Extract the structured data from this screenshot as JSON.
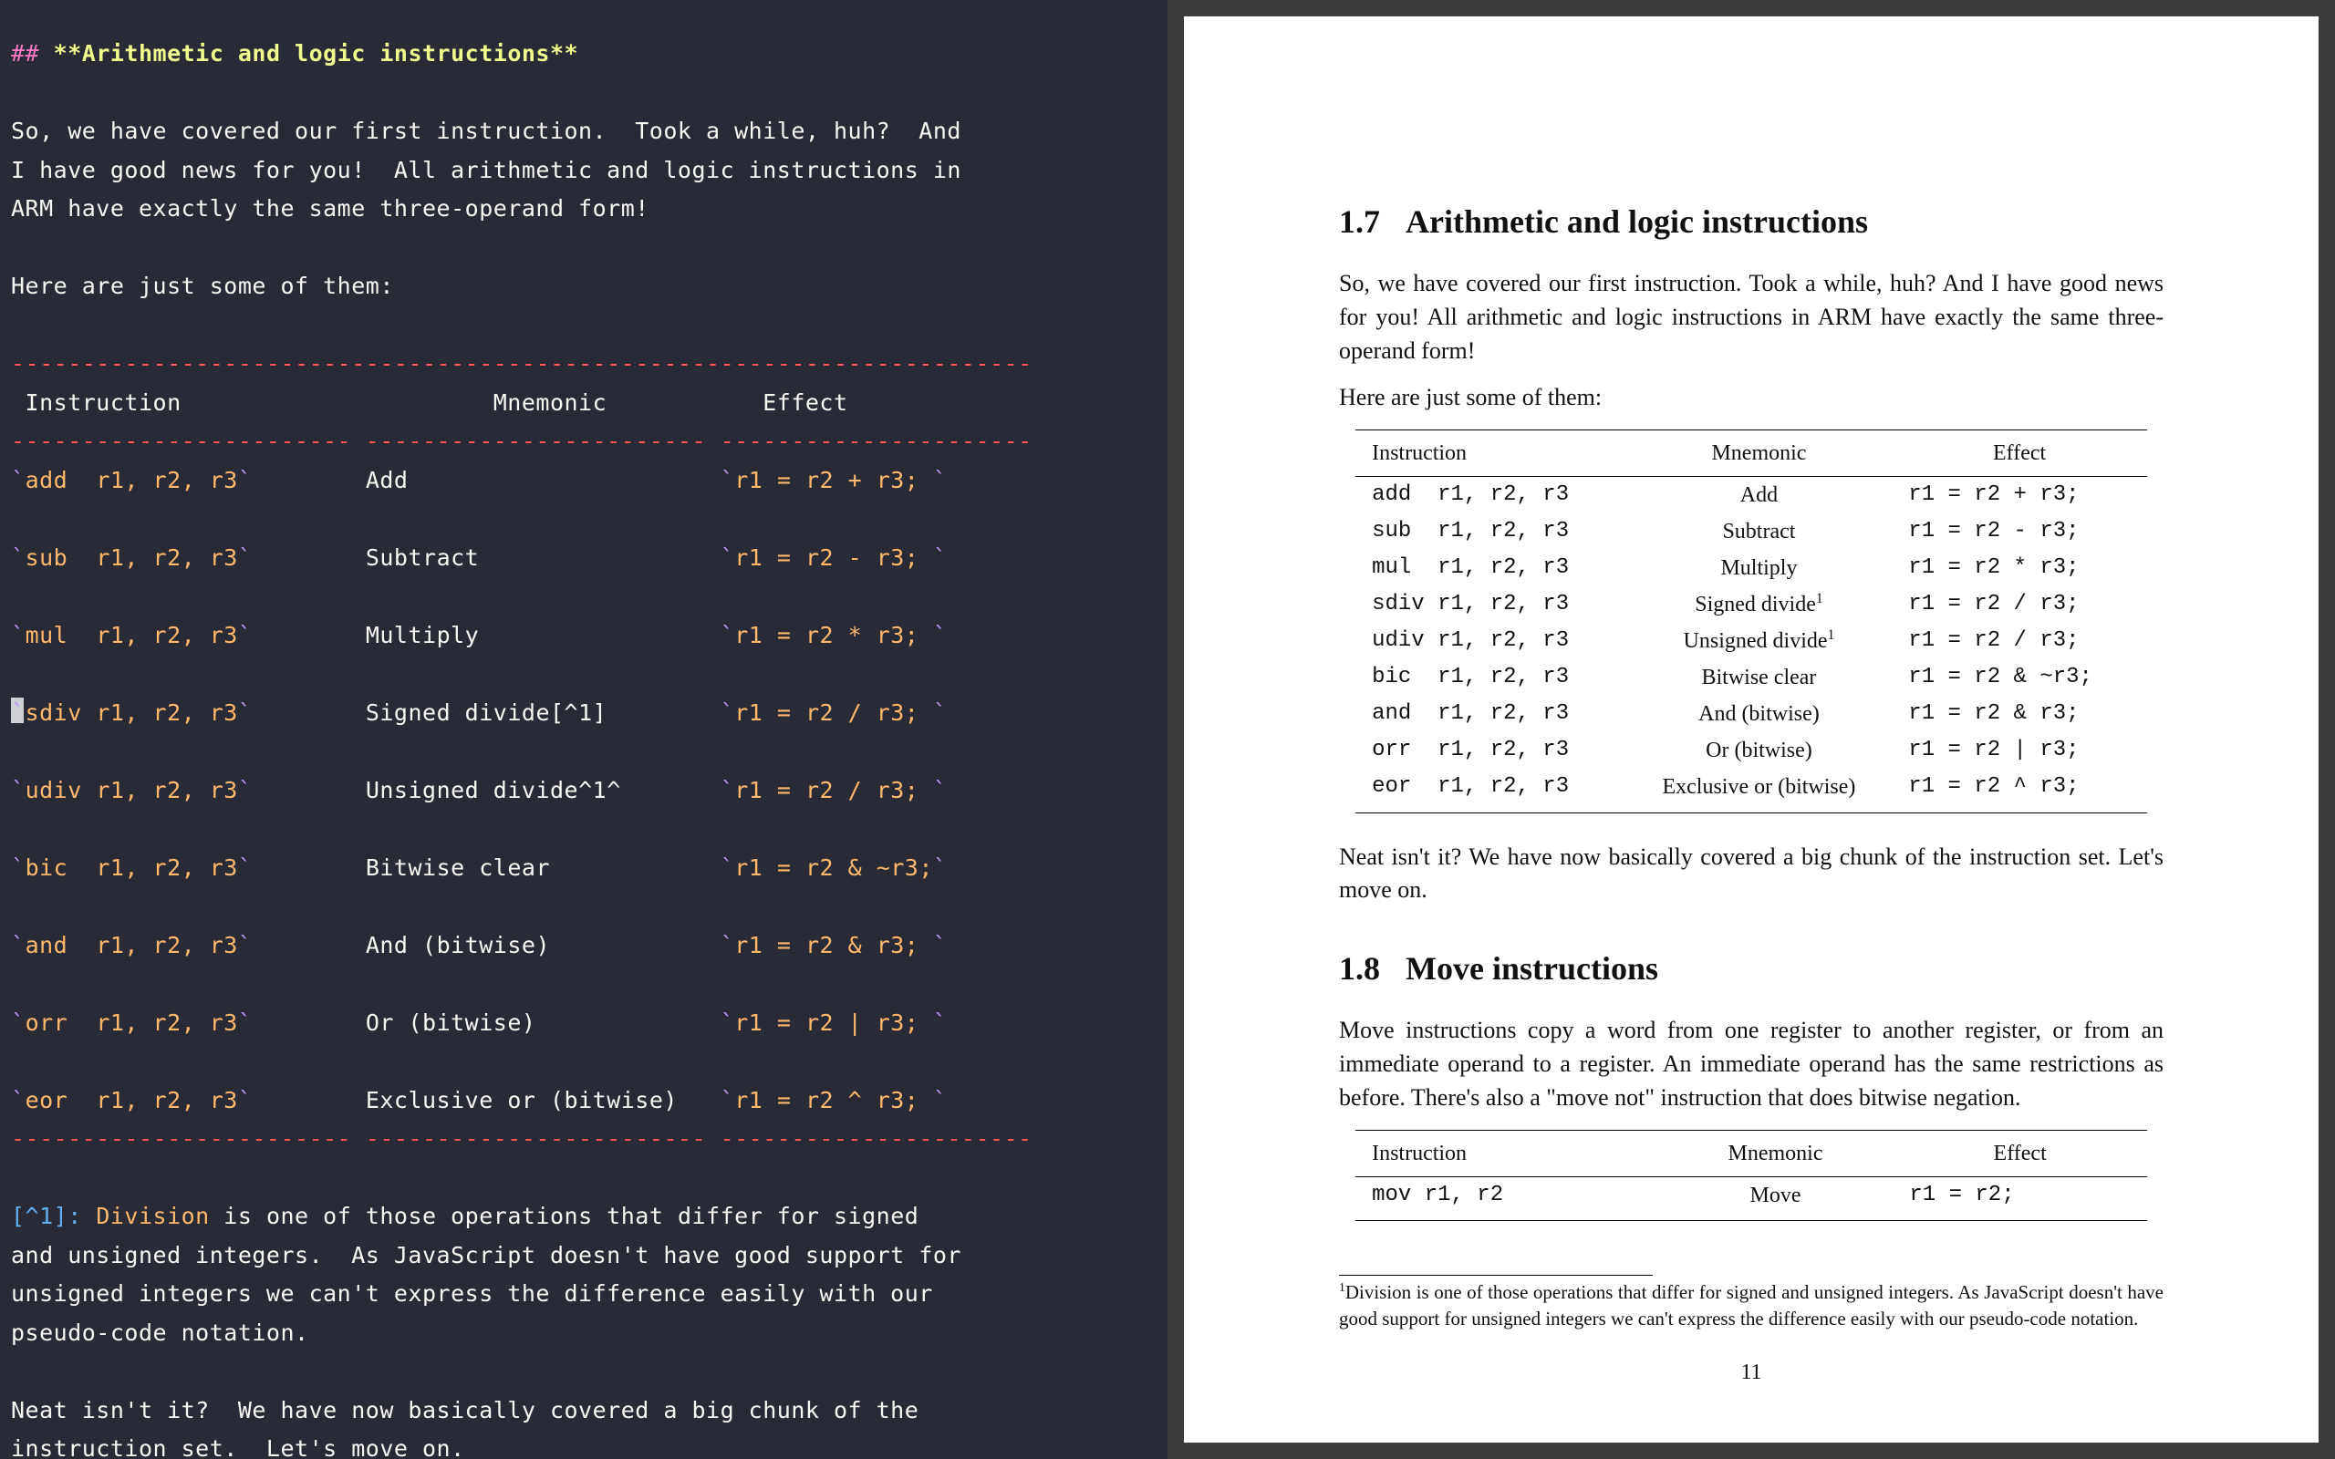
{
  "editor": {
    "header_marker": "##",
    "header_text": "Arithmetic and logic instructions",
    "para1_a": "So, we have covered our first instruction.  Took a while, huh?  And",
    "para1_b": "I have good news for you!  All arithmetic and logic instructions in",
    "para1_c": "ARM have exactly the same three-operand form!",
    "para2": "Here are just some of them:",
    "rule_top": "------------------------------------------------------------------------",
    "th_instr": " Instruction",
    "th_mnem": "Mnemonic",
    "th_eff": "Effect",
    "rule_head": "------------------------ ------------------------ ----------------------",
    "rows": [
      {
        "ins": "add  r1, r2, r3",
        "mnem": "Add",
        "eff": "r1 = r2 + r3; "
      },
      {
        "ins": "sub  r1, r2, r3",
        "mnem": "Subtract",
        "eff": "r1 = r2 - r3; "
      },
      {
        "ins": "mul  r1, r2, r3",
        "mnem": "Multiply",
        "eff": "r1 = r2 * r3; "
      },
      {
        "ins": "sdiv r1, r2, r3",
        "mnem": "Signed divide[^1]",
        "eff": "r1 = r2 / r3; "
      },
      {
        "ins": "udiv r1, r2, r3",
        "mnem": "Unsigned divide^1^",
        "eff": "r1 = r2 / r3; "
      },
      {
        "ins": "bic  r1, r2, r3",
        "mnem": "Bitwise clear",
        "eff": "r1 = r2 & ~r3;"
      },
      {
        "ins": "and  r1, r2, r3",
        "mnem": "And (bitwise)",
        "eff": "r1 = r2 & r3; "
      },
      {
        "ins": "orr  r1, r2, r3",
        "mnem": "Or (bitwise)",
        "eff": "r1 = r2 | r3; "
      },
      {
        "ins": "eor  r1, r2, r3",
        "mnem": "Exclusive or (bitwise)",
        "eff": "r1 = r2 ^ r3; "
      }
    ],
    "rule_bottom": "------------------------ ------------------------ ----------------------",
    "fn_label": "[^1]:",
    "fn_word1": "Division",
    "fn_rest_a": " is one of those operations that differ for signed",
    "fn_b": "and unsigned integers.  As JavaScript doesn't have good support for",
    "fn_c": "unsigned integers we can't express the difference easily with our",
    "fn_d": "pseudo-code notation.",
    "para3_a": "Neat isn't it?  We have now basically covered a big chunk of the",
    "para3_b": "instruction set.  Let's move on.",
    "cursor_row_index": 3
  },
  "pdf": {
    "sec1_num": "1.7",
    "sec1_title": "Arithmetic and logic instructions",
    "sec1_p1": "So, we have covered our first instruction. Took a while, huh? And I have good news for you! All arithmetic and logic instructions in ARM have exactly the same three-operand form!",
    "sec1_p2": "Here are just some of them:",
    "table1_headers": [
      "Instruction",
      "Mnemonic",
      "Effect"
    ],
    "table1": [
      {
        "ins": "add  r1, r2, r3",
        "mnem": "Add",
        "sup": "",
        "eff": "r1 = r2 + r3;"
      },
      {
        "ins": "sub  r1, r2, r3",
        "mnem": "Subtract",
        "sup": "",
        "eff": "r1 = r2 - r3;"
      },
      {
        "ins": "mul  r1, r2, r3",
        "mnem": "Multiply",
        "sup": "",
        "eff": "r1 = r2 * r3;"
      },
      {
        "ins": "sdiv r1, r2, r3",
        "mnem": "Signed divide",
        "sup": "1",
        "eff": "r1 = r2 / r3;"
      },
      {
        "ins": "udiv r1, r2, r3",
        "mnem": "Unsigned divide",
        "sup": "1",
        "eff": "r1 = r2 / r3;"
      },
      {
        "ins": "bic  r1, r2, r3",
        "mnem": "Bitwise clear",
        "sup": "",
        "eff": "r1 = r2 & ~r3;"
      },
      {
        "ins": "and  r1, r2, r3",
        "mnem": "And (bitwise)",
        "sup": "",
        "eff": "r1 = r2 & r3;"
      },
      {
        "ins": "orr  r1, r2, r3",
        "mnem": "Or (bitwise)",
        "sup": "",
        "eff": "r1 = r2 | r3;"
      },
      {
        "ins": "eor  r1, r2, r3",
        "mnem": "Exclusive or (bitwise)",
        "sup": "",
        "eff": "r1 = r2 ^ r3;"
      }
    ],
    "sec1_p3": "Neat isn't it? We have now basically covered a big chunk of the instruction set. Let's move on.",
    "sec2_num": "1.8",
    "sec2_title": "Move instructions",
    "sec2_p1": "Move instructions copy a word from one register to another register, or from an immediate operand to a register. An immediate operand has the same restrictions as before. There's also a \"move not\" instruction that does bitwise negation.",
    "table2_headers": [
      "Instruction",
      "Mnemonic",
      "Effect"
    ],
    "table2": [
      {
        "ins": "mov r1, r2",
        "mnem": "Move",
        "eff": "r1 = r2;"
      }
    ],
    "footnote_sup": "1",
    "footnote": "Division is one of those operations that differ for signed and unsigned integers. As JavaScript doesn't have good support for unsigned integers we can't express the difference easily with our pseudo-code notation.",
    "pagenum": "11"
  }
}
